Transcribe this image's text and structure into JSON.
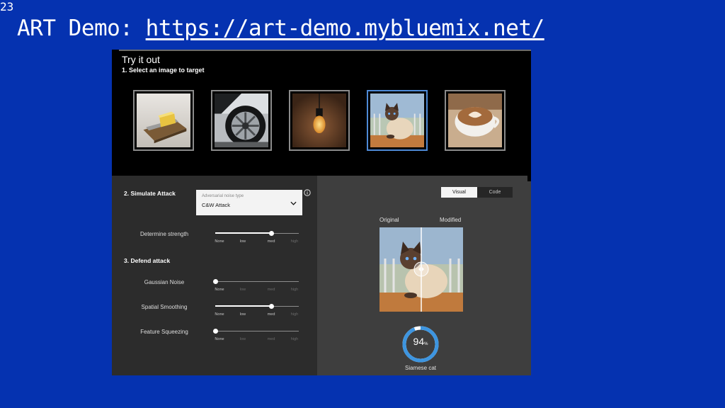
{
  "slide": {
    "number": "23",
    "title_prefix": "ART Demo: ",
    "title_link": " https://art-demo.mybluemix.net/"
  },
  "app": {
    "heading": "Try it out",
    "step1": "1. Select an image to target",
    "thumbnails": [
      {
        "label": "mousetrap",
        "selected": false
      },
      {
        "label": "car wheel",
        "selected": false
      },
      {
        "label": "light bulb",
        "selected": false
      },
      {
        "label": "siamese cat",
        "selected": true
      },
      {
        "label": "coffee cup",
        "selected": false
      }
    ],
    "step2": "2. Simulate Attack",
    "noise_select": {
      "label": "Adversarial noise type",
      "value": "C&W Attack"
    },
    "step3": "3. Defend attack",
    "sliders": [
      {
        "label": "Determine strength",
        "level": 0.67
      },
      {
        "label": "Gaussian Noise",
        "level": 0
      },
      {
        "label": "Spatial Smoothing",
        "level": 0.67
      },
      {
        "label": "Feature Squeezing",
        "level": 0
      }
    ],
    "ticks": [
      "None",
      "low",
      "med",
      "high"
    ],
    "view_toggle": {
      "active": "Visual",
      "inactive": "Code"
    },
    "compare": {
      "original": "Original",
      "modified": "Modified",
      "split": 0.5
    },
    "result": {
      "confidence": "94",
      "unit": "%",
      "confidence_fraction": 0.94,
      "label": "Siamese cat"
    }
  },
  "colors": {
    "slide_bg": "#0532b0",
    "selected_border": "#4e8ad6",
    "ring": "#3d95e0"
  }
}
